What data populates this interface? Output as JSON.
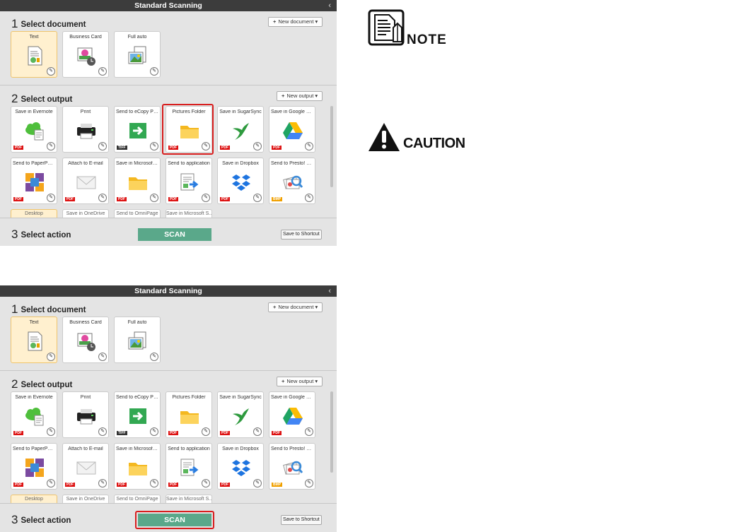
{
  "window": {
    "title": "Standard Scanning",
    "collapse_icon": "chevron-left-icon"
  },
  "section1": {
    "num": "1",
    "title": "Select document",
    "button_label": "New document"
  },
  "documents": [
    {
      "label": "Text",
      "icon": "text-doc-icon",
      "selected": true
    },
    {
      "label": "Business Card",
      "icon": "business-card-icon",
      "selected": false
    },
    {
      "label": "Full auto",
      "icon": "full-auto-icon",
      "selected": false
    }
  ],
  "section2": {
    "num": "2",
    "title": "Select output",
    "button_label": "New output"
  },
  "outputs": [
    {
      "label": "Save in Evernote",
      "icon": "evernote-cloud-icon",
      "badge": "PDF"
    },
    {
      "label": "Print",
      "icon": "printer-icon",
      "badge": ""
    },
    {
      "label": "Send to eCopy PD...",
      "icon": "ecopy-arrow-icon",
      "badge": "TIFF"
    },
    {
      "label": "Pictures Folder",
      "icon": "folder-icon",
      "badge": "PDF"
    },
    {
      "label": "Save in SugarSync",
      "icon": "sugarsync-bird-icon",
      "badge": "PDF"
    },
    {
      "label": "Save in Google Dri...",
      "icon": "google-drive-icon",
      "badge": "PDF"
    },
    {
      "label": "Send to PaperPort ...",
      "icon": "paperport-icon",
      "badge": "PDF"
    },
    {
      "label": "Attach to E-mail",
      "icon": "email-envelope-icon",
      "badge": "PDF"
    },
    {
      "label": "Save in Microsoft S...",
      "icon": "folder-icon",
      "badge": "PDF"
    },
    {
      "label": "Send to application",
      "icon": "send-to-app-icon",
      "badge": "PDF"
    },
    {
      "label": "Save in Dropbox",
      "icon": "dropbox-icon",
      "badge": "PDF"
    },
    {
      "label": "Send to Presto! Biz...",
      "icon": "presto-biz-icon",
      "badge": "BMP"
    }
  ],
  "outputs_partial": [
    "Desktop",
    "Save in OneDrive",
    "Send to OmniPage",
    "Save in Microsoft S..."
  ],
  "section3": {
    "num": "3",
    "title": "Select action",
    "scan_label": "SCAN",
    "shortcut_label": "Save to Shortcut"
  },
  "note": {
    "label": "NOTE",
    "icon": "note-document-icon"
  },
  "caution": {
    "label": "CAUTION",
    "icon": "caution-triangle-icon"
  },
  "colors": {
    "titlebar": "#3c3c3c",
    "scan": "#5aa88a",
    "highlight": "#d81e1e",
    "selected_tile": "#fff0cf"
  }
}
